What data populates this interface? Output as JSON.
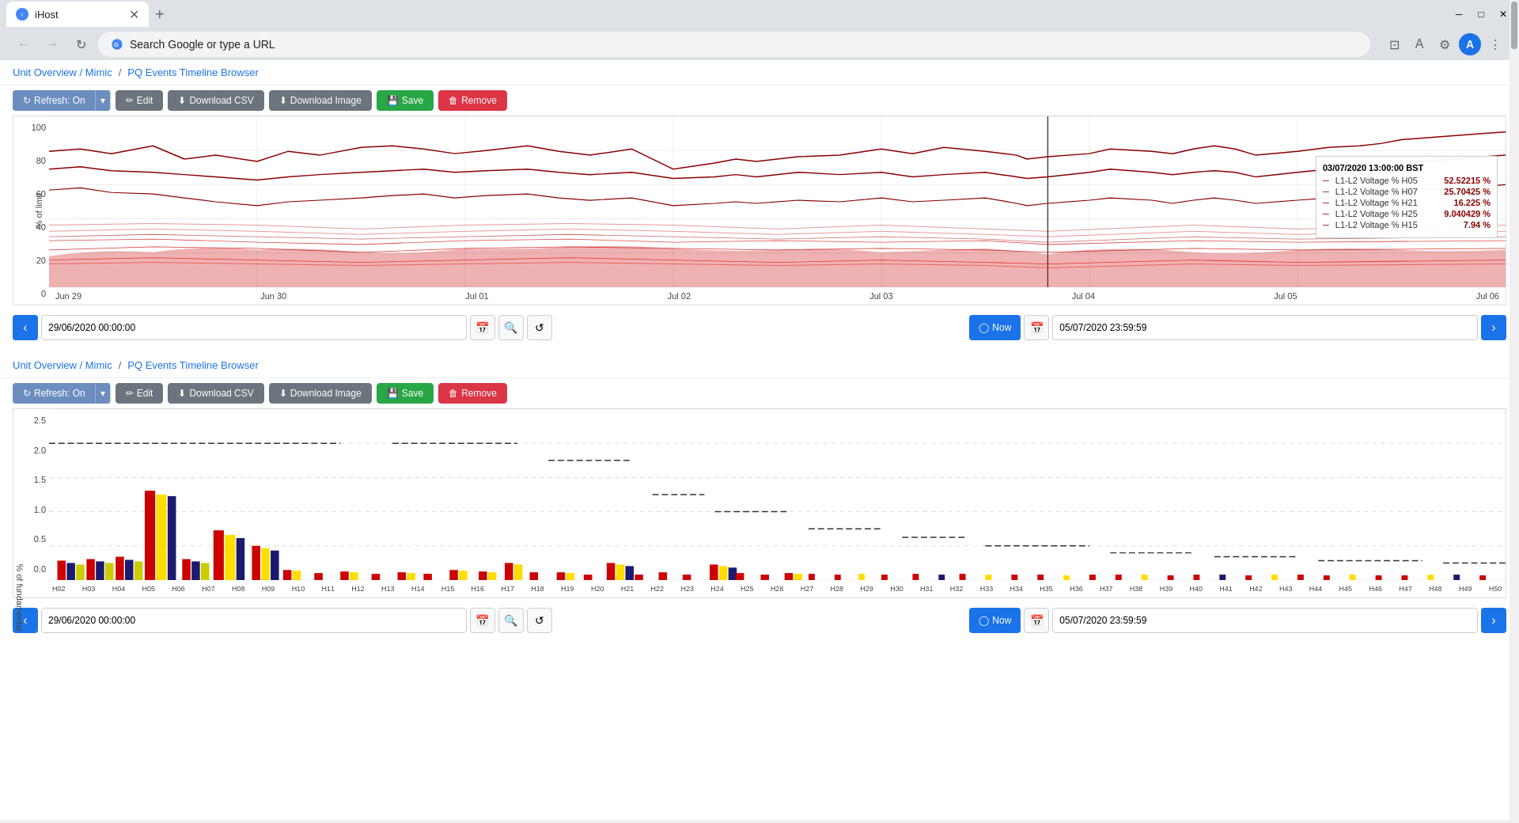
{
  "browser": {
    "tab_title": "iHost",
    "address_placeholder": "Search Google or type a URL",
    "address_text": "Search Google or type a URL"
  },
  "breadcrumbs": {
    "link1": "Unit Overview / Mimic",
    "separator": "/",
    "link2": "PQ Events Timeline Browser"
  },
  "toolbar": {
    "refresh_label": "Refresh: On",
    "edit_label": "Edit",
    "csv_label": "Download CSV",
    "image_label": "Download Image",
    "save_label": "Save",
    "remove_label": "Remove"
  },
  "chart1": {
    "y_labels": [
      "100",
      "80",
      "60",
      "40",
      "20",
      "0"
    ],
    "y_axis_title": "% of limit",
    "x_labels": [
      "Jun 29",
      "Jun 30",
      "Jul 01",
      "Jul 02",
      "Jul 03",
      "Jul 04",
      "Jul 05",
      "Jul 06"
    ],
    "tooltip": {
      "title": "03/07/2020 13:00:00 BST",
      "rows": [
        {
          "label": "L1-L2 Voltage % H05",
          "value": "52.52215 %"
        },
        {
          "label": "L1-L2 Voltage % H07",
          "value": "25.70425 %"
        },
        {
          "label": "L1-L2 Voltage % H21",
          "value": "16.225 %"
        },
        {
          "label": "L1-L2 Voltage % H25",
          "value": "9.040429 %"
        },
        {
          "label": "L1-L2 Voltage % H15",
          "value": "7.94 %"
        }
      ]
    },
    "date_start": "29/06/2020 00:00:00",
    "date_end": "05/07/2020 23:59:59",
    "now_label": "Now"
  },
  "chart2": {
    "y_labels": [
      "2.5",
      "2.0",
      "1.5",
      "1.0",
      "0.5",
      "0.0"
    ],
    "y_axis_title": "% of fundamental",
    "x_labels": [
      "H02",
      "H03",
      "H04",
      "H05",
      "H06",
      "H07",
      "H08",
      "H09",
      "H10",
      "H11",
      "H12",
      "H13",
      "H14",
      "H15",
      "H16",
      "H17",
      "H18",
      "H19",
      "H20",
      "H21",
      "H22",
      "H23",
      "H24",
      "H25",
      "H26",
      "H27",
      "H28",
      "H29",
      "H30",
      "H31",
      "H32",
      "H33",
      "H34",
      "H35",
      "H36",
      "H37",
      "H38",
      "H39",
      "H40",
      "H41",
      "H42",
      "H43",
      "H44",
      "H45",
      "H46",
      "H47",
      "H48",
      "H49",
      "H50"
    ],
    "date_start": "29/06/2020 00:00:00",
    "date_end": "05/07/2020 23:59:59",
    "now_label": "Now"
  },
  "colors": {
    "primary": "#1a73e8",
    "refresh": "#5b7fb5",
    "edit": "#6c757d",
    "save": "#28a745",
    "remove": "#dc3545",
    "chart_line": "#8b0000",
    "chart_fill": "#cc0000"
  }
}
